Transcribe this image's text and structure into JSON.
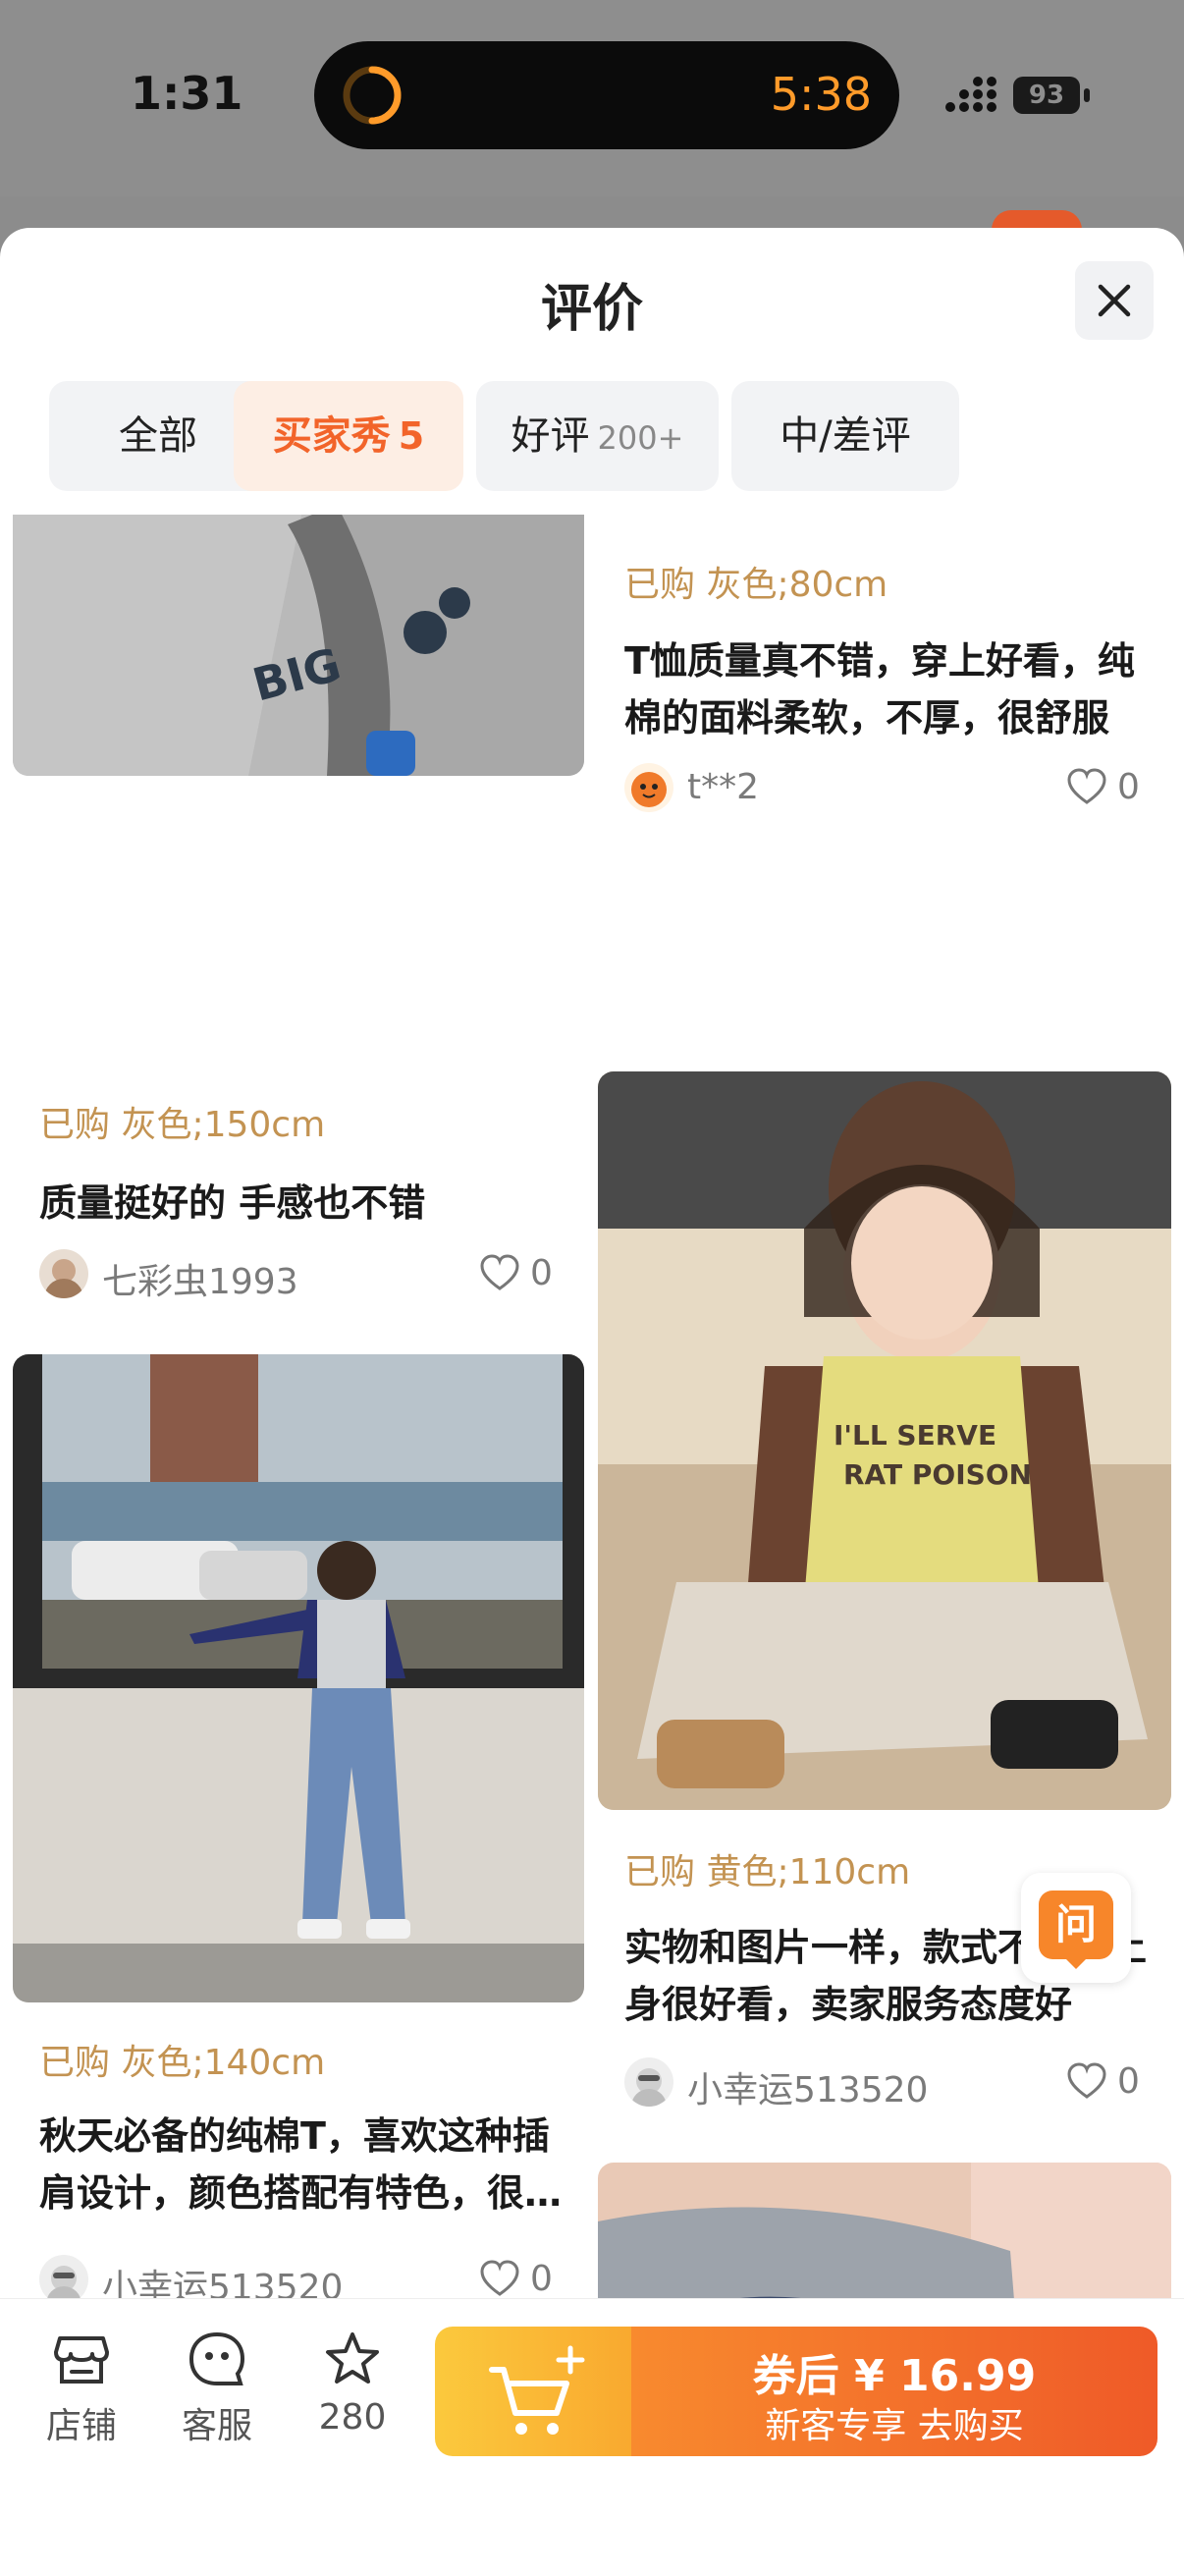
{
  "status_bar": {
    "time": "1:31",
    "timer": "5:38",
    "battery": "93"
  },
  "sheet": {
    "title": "评价"
  },
  "tabs": [
    {
      "label": "全部",
      "count": ""
    },
    {
      "label": "买家秀",
      "count": "5"
    },
    {
      "label": "好评",
      "count": "200+"
    },
    {
      "label": "中/差评",
      "count": ""
    }
  ],
  "reviews": [
    {
      "spec": "已购 灰色;150cm",
      "text": "质量挺好的 手感也不错",
      "user": "七彩虫1993",
      "likes": "0"
    },
    {
      "spec": "已购 灰色;140cm",
      "text": "秋天必备的纯棉T，喜欢这种插肩设计，颜色搭配有特色，很好看",
      "user": "小幸运513520",
      "likes": "0"
    },
    {
      "spec": "已购 灰色;80cm",
      "text": "T恤质量真不错，穿上好看，纯棉的面料柔软，不厚，很舒服",
      "user": "t**2",
      "likes": "0"
    },
    {
      "spec": "已购 黄色;110cm",
      "text": "实物和图片一样，款式不错，上身很好看，卖家服务态度好",
      "user": "小幸运513520",
      "likes": "0"
    }
  ],
  "ask_button": {
    "label": "问"
  },
  "bottom_bar": {
    "shop": "店铺",
    "service": "客服",
    "favorites": "280",
    "buy_price": "券后 ¥ 16.99",
    "buy_label": "新客专享 去购买"
  },
  "colors": {
    "accent": "#f2642a",
    "spec": "#c39352",
    "cart": "#fbc93d",
    "buy": "#ef5a28"
  }
}
